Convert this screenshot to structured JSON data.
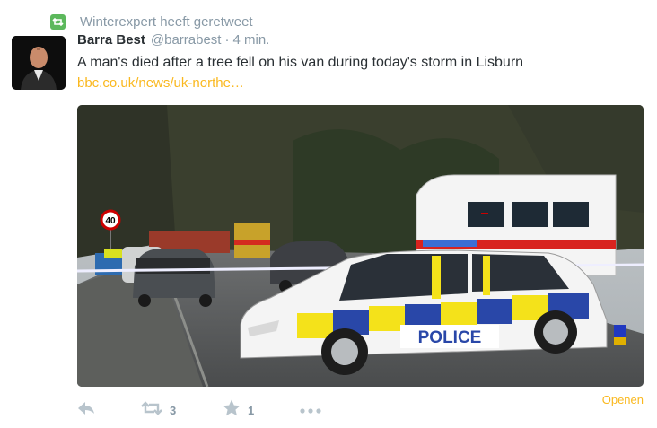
{
  "retweet_context": {
    "text": "Winterexpert heeft geretweet"
  },
  "tweet": {
    "fullname": "Barra Best",
    "username": "@barrabest",
    "separator": "·",
    "time": "4 min.",
    "text": "A man's died after a tree fell on his van during today's storm in Lisburn",
    "link": "bbc.co.uk/news/uk-northe…"
  },
  "media": {
    "police_label": "POLICE",
    "speed_sign": "40"
  },
  "actions": {
    "retweet_count": "3",
    "favorite_count": "1"
  },
  "open_label": "Openen",
  "colors": {
    "link": "#fab81e",
    "muted": "#8899a6",
    "text": "#292f33",
    "retweet_green": "#5cb85c"
  }
}
